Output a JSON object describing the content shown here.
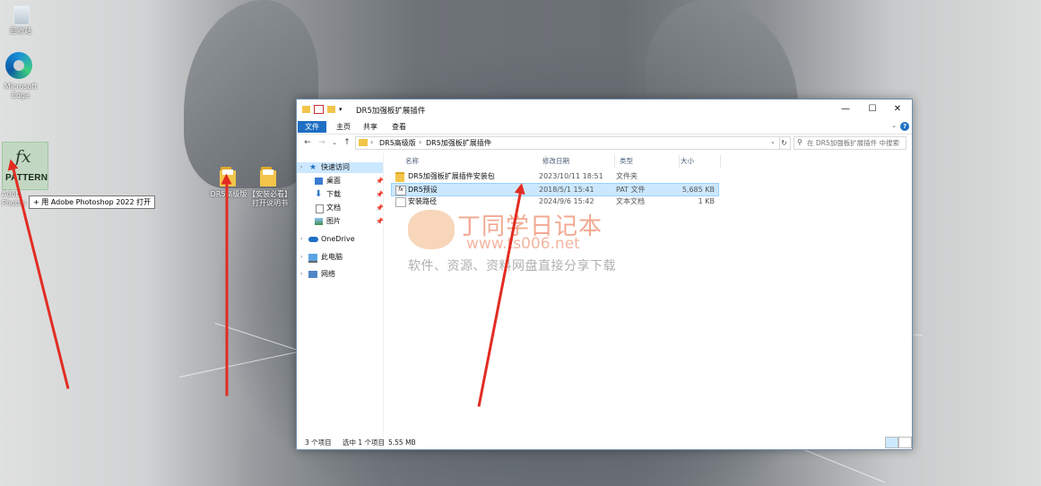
{
  "desktop": {
    "recycle_bin_label": "回收站",
    "edge_label": "Microsoft\nEdge",
    "pattern_icon_text": "PATTERN",
    "pattern_fx_text": "fx",
    "adobe_label_partial": "Adob\nPhotos",
    "drag_tooltip": "+ 用 Adobe Photoshop 2022 打开",
    "folder1_label": "DR5高级版",
    "folder2_label": "【安装必看】\n打开说明书"
  },
  "window": {
    "title": "DR5加强板扩展插件",
    "ribbon_tabs": [
      "文件",
      "主页",
      "共享",
      "查看"
    ],
    "controls": {
      "minimize": "—",
      "maximize": "☐",
      "close": "✕"
    },
    "help": "?",
    "breadcrumb": [
      "DR5高级版",
      "DR5加强板扩展插件"
    ],
    "search_placeholder": "在 DR5加强板扩展插件 中搜索",
    "nav": {
      "quick_access": "快速访问",
      "desktop": "桌面",
      "downloads": "下载",
      "documents": "文档",
      "pictures": "图片",
      "onedrive": "OneDrive",
      "this_pc": "此电脑",
      "network": "网络"
    },
    "columns": {
      "name": "名称",
      "modified": "修改日期",
      "type": "类型",
      "size": "大小"
    },
    "files": [
      {
        "name": "DR5加强板扩展插件安装包",
        "modified": "2023/10/11 18:51",
        "type": "文件夹",
        "size": ""
      },
      {
        "name": "DR5预设",
        "modified": "2018/5/1 15:41",
        "type": "PAT 文件",
        "size": "5,685 KB"
      },
      {
        "name": "安装路径",
        "modified": "2024/9/6 15:42",
        "type": "文本文档",
        "size": "1 KB"
      }
    ],
    "status": {
      "count": "3 个项目",
      "selected": "选中 1 个项目",
      "size": "5.55 MB"
    }
  },
  "watermark": {
    "title": "丁同学日记本",
    "url": "www.ts006.net",
    "slogan": "软件、资源、资料网盘直接分享下载"
  },
  "colors": {
    "accent": "#1f6fc3",
    "selection": "#cce8ff",
    "arrow": "#e22c22",
    "folder": "#f2c54a"
  }
}
